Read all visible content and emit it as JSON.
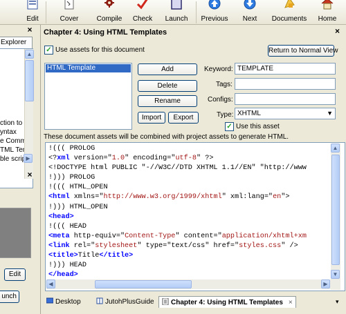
{
  "toolbar": {
    "items": [
      {
        "label": "Edit",
        "icon": "list-edit-icon"
      },
      {
        "label": "Cover",
        "icon": "cover-icon"
      },
      {
        "label": "Compile",
        "icon": "gear-icon"
      },
      {
        "label": "Check",
        "icon": "checkmark-icon"
      },
      {
        "label": "Launch",
        "icon": "launch-window-icon"
      },
      {
        "label": "Previous",
        "icon": "arrow-up-icon"
      },
      {
        "label": "Next",
        "icon": "arrow-down-icon"
      },
      {
        "label": "Documents",
        "icon": "documents-icon"
      },
      {
        "label": "Home",
        "icon": "home-icon"
      }
    ]
  },
  "left": {
    "tab_label": "Explorer",
    "list_items": [
      "ction to J",
      "yntax",
      "e Comm",
      "TML Tem",
      "ble script"
    ],
    "edit_label": "Edit",
    "launch_label": "unch"
  },
  "main": {
    "title": "Chapter 4: Using HTML Templates",
    "use_assets_label": "Use assets for this document",
    "normal_view_label": "Return to Normal View",
    "asset_list": [
      "HTML Template"
    ],
    "buttons": {
      "add": "Add",
      "delete": "Delete",
      "rename": "Rename",
      "import": "Import",
      "export": "Export"
    },
    "keyword_label": "Keyword:",
    "keyword_value": "TEMPLATE",
    "tags_label": "Tags:",
    "tags_value": "",
    "configs_label": "Configs:",
    "configs_value": "",
    "type_label": "Type:",
    "type_value": "XHTML",
    "use_asset_label": "Use this asset",
    "info_text": "These document assets will be combined with project assets to generate HTML."
  },
  "tabs": [
    {
      "label": "Desktop",
      "icon": "desktop-icon"
    },
    {
      "label": "JutohPlusGuide",
      "icon": "book-icon"
    },
    {
      "label": "Chapter 4: Using HTML Templates",
      "icon": "page-icon",
      "active": true
    }
  ],
  "colors": {
    "selection": "#316ac5",
    "keyword": "#0000ff",
    "string": "#a31515"
  }
}
